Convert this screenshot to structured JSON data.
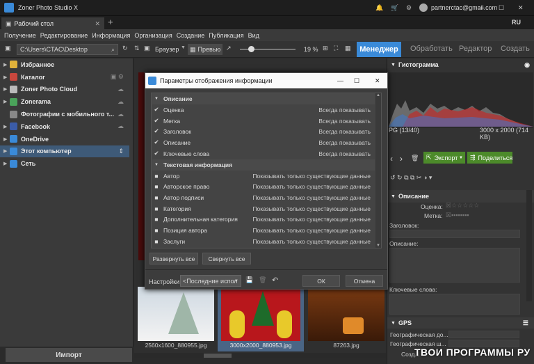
{
  "window": {
    "title": "Zoner Photo Studio X",
    "account": "partnerctac@gmail.com",
    "lang": "RU"
  },
  "tabs": [
    {
      "label": "Рабочий стол"
    }
  ],
  "menu": [
    "Получение",
    "Редактирование",
    "Информация",
    "Организация",
    "Создание",
    "Публикация",
    "Вид"
  ],
  "toolbar": {
    "path": "C:\\Users\\CTAC\\Desktop",
    "browser": "Браузер",
    "preview": "Превью",
    "zoom": "19 %",
    "modes": [
      "Менеджер",
      "Обработать",
      "Редактор",
      "Создать"
    ]
  },
  "sidebar": {
    "items": [
      {
        "label": "Избранное",
        "color": "#e0b23a"
      },
      {
        "label": "Каталог",
        "color": "#c9473d"
      },
      {
        "label": "Zoner Photo Cloud",
        "color": "#bbbbbb"
      },
      {
        "label": "Zonerama",
        "color": "#4aa35a"
      },
      {
        "label": "Фотографии с мобильного т...",
        "color": "#888888"
      },
      {
        "label": "Facebook",
        "color": "#3b5ca8"
      },
      {
        "label": "OneDrive",
        "color": "#3a8ad8"
      },
      {
        "label": "Этот компьютер",
        "color": "#3a8ad8"
      },
      {
        "label": "Сеть",
        "color": "#3a8ad8"
      }
    ],
    "import": "Импорт"
  },
  "dialog": {
    "title": "Параметры отображения информации",
    "sections": [
      {
        "label": "Описание",
        "rows": [
          {
            "label": "Оценка",
            "value": "Всегда показывать"
          },
          {
            "label": "Метка",
            "value": "Всегда показывать"
          },
          {
            "label": "Заголовок",
            "value": "Всегда показывать"
          },
          {
            "label": "Описание",
            "value": "Всегда показывать"
          },
          {
            "label": "Ключевые слова",
            "value": "Всегда показывать"
          }
        ]
      },
      {
        "label": "Текстовая информация",
        "rows": [
          {
            "label": "Автор",
            "value": "Показывать только существующие данные"
          },
          {
            "label": "Авторское право",
            "value": "Показывать только существующие данные"
          },
          {
            "label": "Автор подписи",
            "value": "Показывать только существующие данные"
          },
          {
            "label": "Категория",
            "value": "Показывать только существующие данные"
          },
          {
            "label": "Дополнительная категория",
            "value": "Показывать только существующие данные"
          },
          {
            "label": "Позиция автора",
            "value": "Показывать только существующие данные"
          },
          {
            "label": "Заслуги",
            "value": "Показывать только существующие данные"
          }
        ]
      }
    ],
    "expand_all": "Развернуть все",
    "collapse_all": "Свернуть все",
    "settings_label": "Настройки:",
    "settings_value": "<Последние испол",
    "ok": "ОК",
    "cancel": "Отмена"
  },
  "thumbs": [
    {
      "label": "2560x1600_880955.jpg"
    },
    {
      "label": "3000x2000_880953.jpg"
    },
    {
      "label": "87263.jpg"
    }
  ],
  "right": {
    "histogram": "Гистограмма",
    "file_suffix": "PG (13/40)",
    "dims": "3000 x 2000 (714 KB)",
    "export": "Экспорт",
    "share": "Поделиться",
    "description": "Описание",
    "rating": "Оценка:",
    "label": "Метка:",
    "title": "Заголовок:",
    "desc": "Описание:",
    "keywords": "Ключевые слова:",
    "gps": "GPS",
    "lat": "Географическая до...",
    "lon": "Географическая ш...",
    "create": "Созд..."
  },
  "watermark": "ТВОИ ПРОГРАММЫ РУ"
}
